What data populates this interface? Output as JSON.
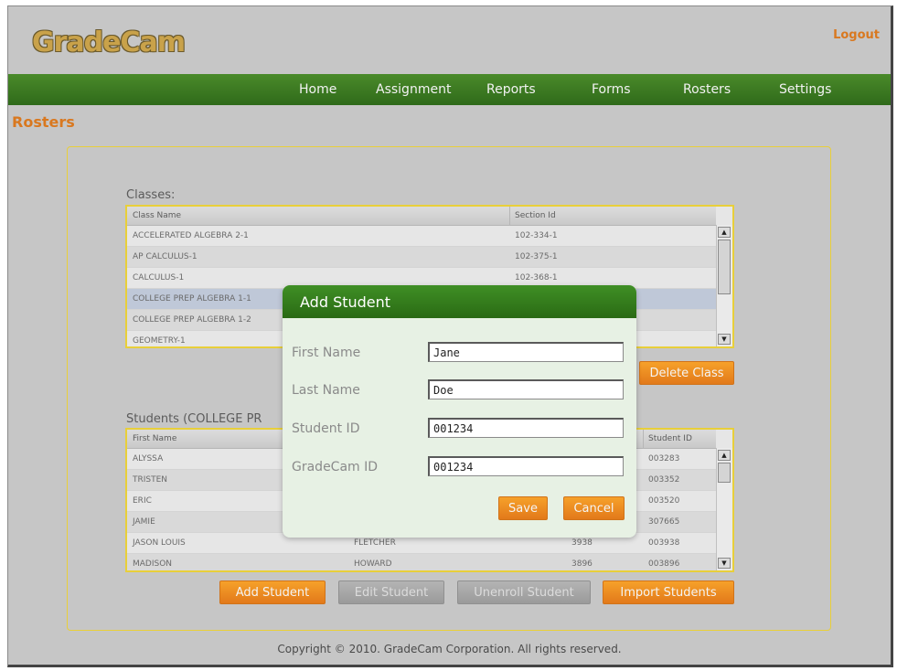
{
  "header": {
    "logo": "GradeCam",
    "logout": "Logout"
  },
  "nav": {
    "items": [
      "Home",
      "Assignment",
      "Reports",
      "Forms",
      "Rosters",
      "Settings"
    ]
  },
  "page_title": "Rosters",
  "classes": {
    "label": "Classes:",
    "columns": [
      "Class Name",
      "Section Id"
    ],
    "rows": [
      [
        "ACCELERATED ALGEBRA 2-1",
        "102-334-1"
      ],
      [
        "AP CALCULUS-1",
        "102-375-1"
      ],
      [
        "CALCULUS-1",
        "102-368-1"
      ],
      [
        "COLLEGE PREP ALGEBRA 1-1",
        ""
      ],
      [
        "COLLEGE PREP ALGEBRA 1-2",
        ""
      ],
      [
        "GEOMETRY-1",
        ""
      ]
    ],
    "delete_button": "Delete Class"
  },
  "students": {
    "label": "Students (COLLEGE PR",
    "columns": [
      "First Name",
      "Student ID"
    ],
    "rows": [
      [
        "ALYSSA",
        "",
        "",
        "003283"
      ],
      [
        "TRISTEN",
        "",
        "",
        "003352"
      ],
      [
        "ERIC",
        "",
        "",
        "003520"
      ],
      [
        "JAMIE",
        "",
        "",
        "307665"
      ],
      [
        "JASON LOUIS",
        "FLETCHER",
        "3938",
        "003938"
      ],
      [
        "MADISON",
        "HOWARD",
        "3896",
        "003896"
      ]
    ],
    "buttons": {
      "add": "Add Student",
      "edit": "Edit Student",
      "unenroll": "Unenroll Student",
      "import": "Import Students"
    }
  },
  "modal": {
    "title": "Add Student",
    "fields": [
      {
        "label": "First Name",
        "value": "Jane"
      },
      {
        "label": "Last Name",
        "value": "Doe"
      },
      {
        "label": "Student ID",
        "value": "001234"
      },
      {
        "label": "GradeCam ID",
        "value": "001234"
      }
    ],
    "save": "Save",
    "cancel": "Cancel"
  },
  "footer": {
    "copyright": "Copyright © 2010. GradeCam Corporation. All rights reserved."
  },
  "colors": {
    "brand_green": "#2f6a1a",
    "accent_orange": "#e2791a",
    "panel_border": "#e8cf3a"
  }
}
